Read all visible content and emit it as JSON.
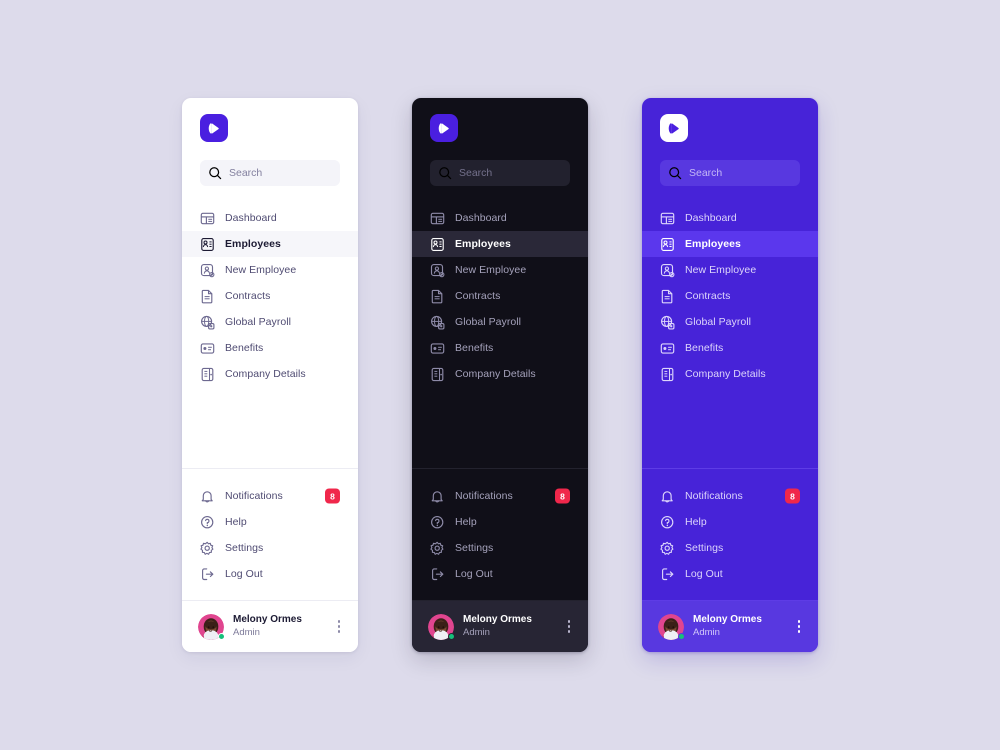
{
  "brand": {
    "logo_icon": "play-cursor-logo-icon",
    "accent_color": "#4a1fe0",
    "badge_color": "#f0274b"
  },
  "page": {
    "background_color": "#dddbeb"
  },
  "search": {
    "placeholder": "Search",
    "value": "",
    "icon": "search-icon"
  },
  "nav_main": [
    {
      "label": "Dashboard",
      "icon": "dashboard-icon",
      "active": false
    },
    {
      "label": "Employees",
      "icon": "employees-badge-icon",
      "active": true
    },
    {
      "label": "New Employee",
      "icon": "new-employee-icon",
      "active": false
    },
    {
      "label": "Contracts",
      "icon": "contract-document-icon",
      "active": false
    },
    {
      "label": "Global Payroll",
      "icon": "globe-payroll-icon",
      "active": false
    },
    {
      "label": "Benefits",
      "icon": "benefits-card-icon",
      "active": false
    },
    {
      "label": "Company Details",
      "icon": "company-building-icon",
      "active": false
    }
  ],
  "nav_bottom": [
    {
      "label": "Notifications",
      "icon": "bell-icon",
      "badge": "8"
    },
    {
      "label": "Help",
      "icon": "help-icon",
      "badge": ""
    },
    {
      "label": "Settings",
      "icon": "gear-icon",
      "badge": ""
    },
    {
      "label": "Log Out",
      "icon": "logout-icon",
      "badge": ""
    }
  ],
  "footer": {
    "name": "Melony Ormes",
    "role": "Admin",
    "avatar": "user-avatar",
    "status": "online",
    "menu_icon": "kebab-menu-icon"
  },
  "panels": [
    {
      "theme": "light",
      "name": "light-sidebar"
    },
    {
      "theme": "dark",
      "name": "dark-sidebar"
    },
    {
      "theme": "purple",
      "name": "purple-sidebar"
    }
  ]
}
